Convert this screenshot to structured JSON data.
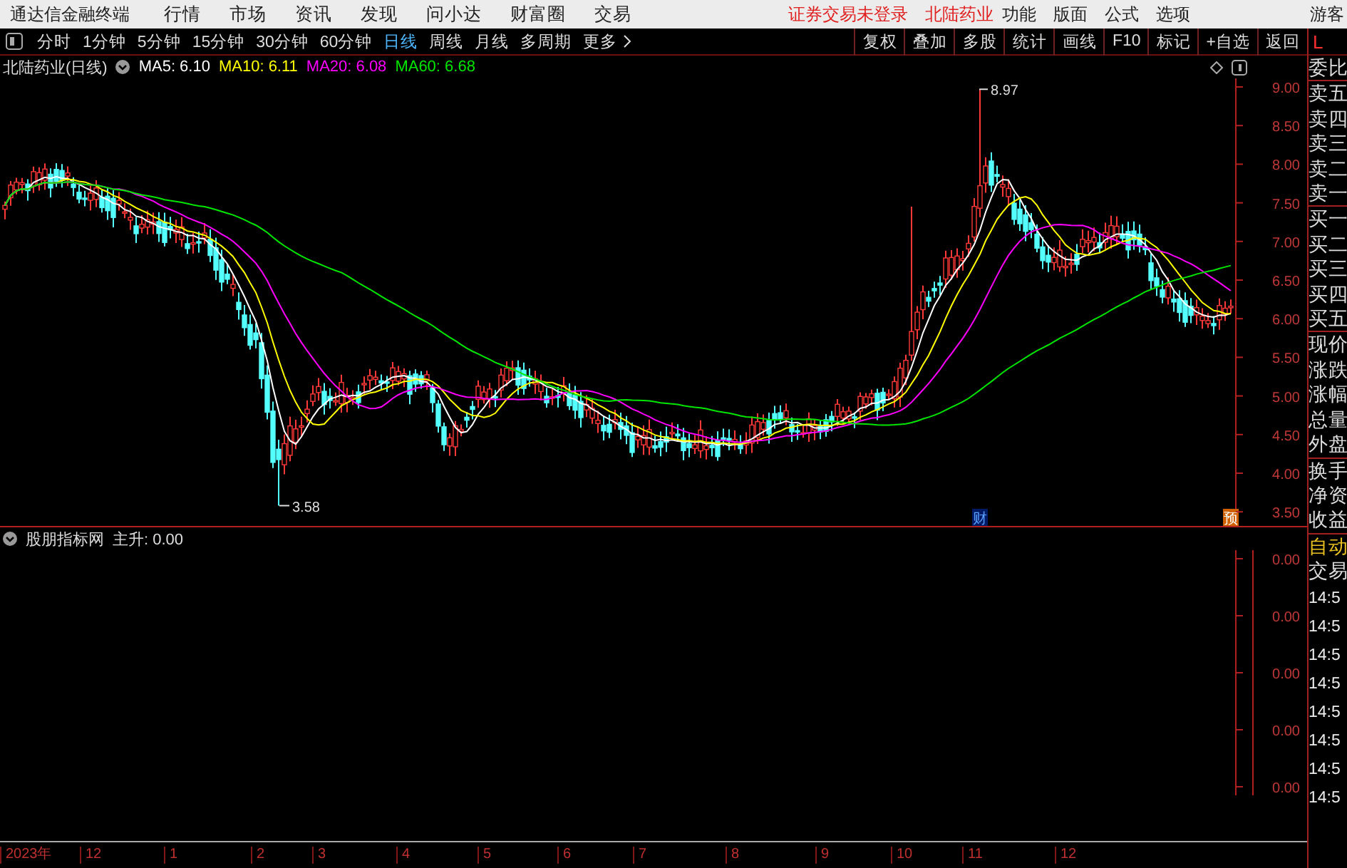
{
  "top_bar": {
    "app_title": "通达信金融终端",
    "menu": [
      "行情",
      "市场",
      "资讯",
      "发现",
      "问小达",
      "财富圈",
      "交易"
    ],
    "status_notice": "证券交易未登录",
    "stock_name": "北陆药业",
    "tools": [
      "功能",
      "版面",
      "公式",
      "选项"
    ],
    "user": "游客"
  },
  "period_bar": {
    "periods": [
      {
        "label": "分时",
        "selected": false
      },
      {
        "label": "1分钟",
        "selected": false
      },
      {
        "label": "5分钟",
        "selected": false
      },
      {
        "label": "15分钟",
        "selected": false
      },
      {
        "label": "30分钟",
        "selected": false
      },
      {
        "label": "60分钟",
        "selected": false
      },
      {
        "label": "日线",
        "selected": true
      },
      {
        "label": "周线",
        "selected": false
      },
      {
        "label": "月线",
        "selected": false
      },
      {
        "label": "多周期",
        "selected": false
      }
    ],
    "more": "更多",
    "actions": [
      "复权",
      "叠加",
      "多股",
      "统计",
      "画线",
      "F10",
      "标记",
      "+自选",
      "返回"
    ]
  },
  "main_chart": {
    "title": "北陆药业(日线)",
    "indicators": [
      {
        "label": "MA5: 6.10",
        "color": "#ffffff"
      },
      {
        "label": "MA10: 6.11",
        "color": "#ffff00"
      },
      {
        "label": "MA20: 6.08",
        "color": "#ff00ff"
      },
      {
        "label": "MA60: 6.68",
        "color": "#00e600"
      }
    ],
    "high_marker": "8.97",
    "low_marker": "3.58",
    "price_ticks": [
      "9.00",
      "8.50",
      "8.00",
      "7.50",
      "7.00",
      "6.50",
      "6.00",
      "5.50",
      "5.00",
      "4.50",
      "4.00",
      "3.50"
    ],
    "event_tags": [
      {
        "label": "财",
        "kind": "finance"
      },
      {
        "label": "预",
        "kind": "forecast"
      }
    ]
  },
  "indicator_panel": {
    "name": "股朋指标网",
    "reading": "主升: 0.00",
    "value_ticks": [
      "0.00",
      "0.00",
      "0.00",
      "0.00",
      "0.00"
    ]
  },
  "time_axis": [
    "2023年",
    "12",
    "1",
    "2",
    "3",
    "4",
    "5",
    "6",
    "7",
    "8",
    "9",
    "10",
    "11",
    "12"
  ],
  "side_panel": {
    "header": "L",
    "quote_groups": [
      [
        "委比"
      ],
      [
        "卖五",
        "卖四",
        "卖三",
        "卖二",
        "卖一"
      ],
      [
        "买一",
        "买二",
        "买三",
        "买四",
        "买五"
      ],
      [
        "现价",
        "涨跌",
        "涨幅",
        "总量",
        "外盘"
      ],
      [
        "换手",
        "净资",
        "收益"
      ]
    ],
    "trade_mode": "自动",
    "trade_title": "交易",
    "trade_times": [
      "14:5",
      "14:5",
      "14:5",
      "14:5",
      "14:5",
      "14:5",
      "14:5",
      "14:5"
    ]
  }
}
